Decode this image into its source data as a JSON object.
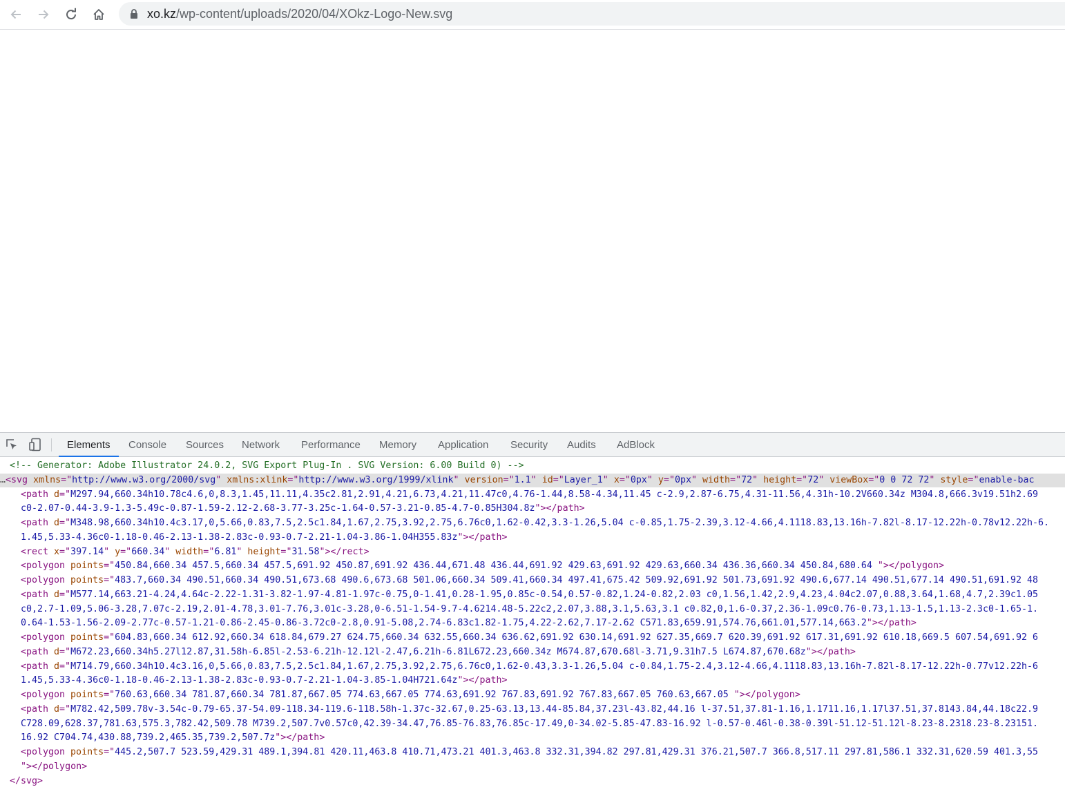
{
  "browser": {
    "url_host": "xo.kz",
    "url_path": "/wp-content/uploads/2020/04/XOkz-Logo-New.svg"
  },
  "devtools": {
    "tabs": [
      "Elements",
      "Console",
      "Sources",
      "Network",
      "Performance",
      "Memory",
      "Application",
      "Security",
      "Audits",
      "AdBlock"
    ],
    "active_tab": "Elements",
    "lines": [
      "<!-- Generator: Adobe Illustrator 24.0.2, SVG Export Plug-In . SVG Version: 6.00 Build 0) -->",
      "<svg xmlns=\"http://www.w3.org/2000/svg\" xmlns:xlink=\"http://www.w3.org/1999/xlink\" version=\"1.1\" id=\"Layer_1\" x=\"0px\" y=\"0px\" width=\"72\" height=\"72\" viewBox=\"0 0 72 72\" style=\"enable-bac",
      "<path d=\"M297.94,660.34h10.78c4.6,0,8.3,1.45,11.11,4.35c2.81,2.91,4.21,6.73,4.21,11.47c0,4.76-1.44,8.58-4.34,11.45 c-2.9,2.87-6.75,4.31-11.56,4.31h-10.2V660.34z M304.8,666.3v19.51h2.69",
      "c0-2.07-0.44-3.9-1.3-5.49c-0.87-1.59-2.12-2.68-3.77-3.25c-1.64-0.57-3.21-0.85-4.7-0.85H304.8z\"></path>",
      "<path d=\"M348.98,660.34h10.4c3.17,0,5.66,0.83,7.5,2.5c1.84,1.67,2.75,3.92,2.75,6.76c0,1.62-0.42,3.3-1.26,5.04 c-0.85,1.75-2.39,3.12-4.66,4.1118.83,13.16h-7.82l-8.17-12.22h-0.78v12.22h-6.",
      "1.45,5.33-4.36c0-1.18-0.46-2.13-1.38-2.83c-0.93-0.7-2.21-1.04-3.86-1.04H355.83z\"></path>",
      "<rect x=\"397.14\" y=\"660.34\" width=\"6.81\" height=\"31.58\"></rect>",
      "<polygon points=\"450.84,660.34 457.5,660.34 457.5,691.92 450.87,691.92 436.44,671.48 436.44,691.92 429.63,691.92 429.63,660.34 436.36,660.34 450.84,680.64 \"></polygon>",
      "<polygon points=\"483.7,660.34 490.51,660.34 490.51,673.68 490.6,673.68 501.06,660.34 509.41,660.34 497.41,675.42 509.92,691.92 501.73,691.92 490.6,677.14 490.51,677.14 490.51,691.92 48",
      "<path d=\"M577.14,663.21-4.24,4.64c-2.22-1.31-3.82-1.97-4.81-1.97c-0.75,0-1.41,0.28-1.95,0.85c-0.54,0.57-0.82,1.24-0.82,2.03 c0,1.56,1.42,2.9,4.23,4.04c2.07,0.88,3.64,1.68,4.7,2.39c1.05",
      "c0,2.7-1.09,5.06-3.28,7.07c-2.19,2.01-4.78,3.01-7.76,3.01c-3.28,0-6.51-1.54-9.7-4.6214.48-5.22c2,2.07,3.88,3.1,5.63,3.1 c0.82,0,1.6-0.37,2.36-1.09c0.76-0.73,1.13-1.5,1.13-2.3c0-1.65-1.",
      "0.64-1.53-1.56-2.09-2.77c-0.57-1.21-0.86-2.45-0.86-3.72c0-2.8,0.91-5.08,2.74-6.83c1.82-1.75,4.22-2.62,7.17-2.62 C571.83,659.91,574.76,661.01,577.14,663.2\"></path>",
      "<polygon points=\"604.83,660.34 612.92,660.34 618.84,679.27 624.75,660.34 632.55,660.34 636.62,691.92 630.14,691.92 627.35,669.7 620.39,691.92 617.31,691.92 610.18,669.5 607.54,691.92 6",
      "<path d=\"M672.23,660.34h5.27l12.87,31.58h-6.85l-2.53-6.21h-12.12l-2.47,6.21h-6.81L672.23,660.34z M674.87,670.68l-3.71,9.31h7.5 L674.87,670.68z\"></path>",
      "<path d=\"M714.79,660.34h10.4c3.16,0,5.66,0.83,7.5,2.5c1.84,1.67,2.75,3.92,2.75,6.76c0,1.62-0.43,3.3-1.26,5.04 c-0.84,1.75-2.4,3.12-4.66,4.1118.83,13.16h-7.82l-8.17-12.22h-0.77v12.22h-6",
      "1.45,5.33-4.36c0-1.18-0.46-2.13-1.38-2.83c-0.93-0.7-2.21-1.04-3.85-1.04H721.64z\"></path>",
      "<polygon points=\"760.63,660.34 781.87,660.34 781.87,667.05 774.63,667.05 774.63,691.92 767.83,691.92 767.83,667.05 760.63,667.05 \"></polygon>",
      "<path d=\"M782.42,509.78v-3.54c-0.79-65.37-54.09-118.34-119.6-118.58h-1.37c-32.67,0.25-63.13,13.44-85.84,37.23l-43.82,44.16 l-37.51,37.81-1.16,1.1711.16,1.17l37.51,37.8143.84,44.18c22.9",
      "C728.09,628.37,781.63,575.3,782.42,509.78 M739.2,507.7v0.57c0,42.39-34.47,76.85-76.83,76.85c-17.49,0-34.02-5.85-47.83-16.92 l-0.57-0.46l-0.38-0.39l-51.12-51.12l-8.23-8.2318.23-8.23151.",
      "16.92 C704.74,430.88,739.2,465.35,739.2,507.7z\"></path>",
      "<polygon points=\"445.2,507.7 523.59,429.31 489.1,394.81 420.11,463.8 410.71,473.21 401.3,463.8 332.31,394.82 297.81,429.31 376.21,507.7 366.8,517.11 297.81,586.1 332.31,620.59 401.3,55",
      "\"></polygon>",
      "</svg>"
    ]
  }
}
